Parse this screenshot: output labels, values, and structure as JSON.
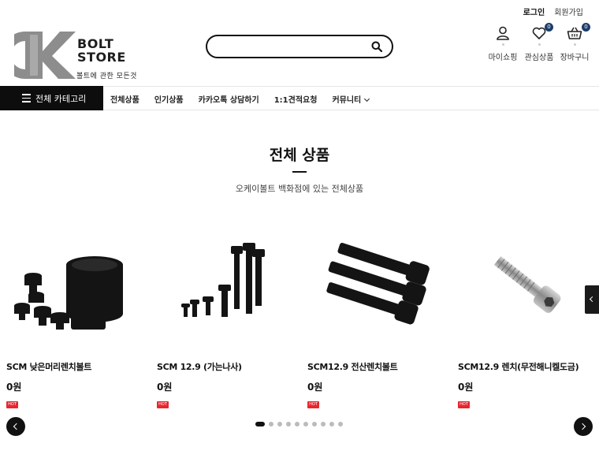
{
  "header": {
    "links": {
      "login": "로그인",
      "signup": "회원가입"
    },
    "logo": {
      "line1": "BOLT",
      "line2": "STORE",
      "tagline": "볼트에 관한 모든것"
    },
    "search": {
      "placeholder": "",
      "icon": "search-icon"
    },
    "icons": [
      {
        "name": "mypage",
        "label": "마이쇼핑",
        "icon": "user-icon"
      },
      {
        "name": "wishlist",
        "label": "관심상품",
        "icon": "heart-icon",
        "count": "0"
      },
      {
        "name": "cart",
        "label": "장바구니",
        "icon": "basket-icon",
        "count": "0"
      }
    ]
  },
  "nav": {
    "all_categories": "전체 카테고리",
    "items": [
      "전체상품",
      "인기상품",
      "카카오톡 상담하기",
      "1:1견적요청",
      "커뮤니티"
    ]
  },
  "section": {
    "title": "전체 상품",
    "subtitle": "오케이볼트 백화점에 있는 전체상품"
  },
  "products": [
    {
      "name": "SCM 낮은머리렌치볼트",
      "price": "0원",
      "badge": "HOT"
    },
    {
      "name": "SCM 12.9 (가는나사)",
      "price": "0원",
      "badge": "HOT"
    },
    {
      "name": "SCM12.9 전산렌치볼트",
      "price": "0원",
      "badge": "HOT"
    },
    {
      "name": "SCM12.9 렌치(무전해니켈도금)",
      "price": "0원",
      "badge": "HOT"
    }
  ],
  "carousel": {
    "pages": 10,
    "active": 1
  },
  "colors": {
    "accent": "#0d0d0d",
    "badge": "#1c3c6b",
    "hot": "#e8262e"
  }
}
